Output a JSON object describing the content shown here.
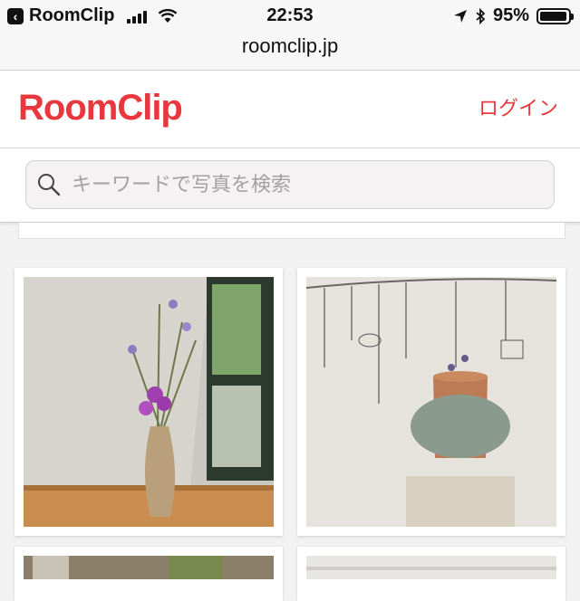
{
  "status": {
    "back_app": "RoomClip",
    "time": "22:53",
    "battery": "95%",
    "battery_level": 0.95
  },
  "url": "roomclip.jp",
  "header": {
    "logo": "RoomClip",
    "login": "ログイン"
  },
  "search": {
    "placeholder": "キーワードで写真を検索"
  },
  "photos": [
    {
      "name": "photo-flowers-vase"
    },
    {
      "name": "photo-wire-garden-lavender"
    },
    {
      "name": "photo-kitchen-plants"
    },
    {
      "name": "photo-white-room"
    }
  ]
}
